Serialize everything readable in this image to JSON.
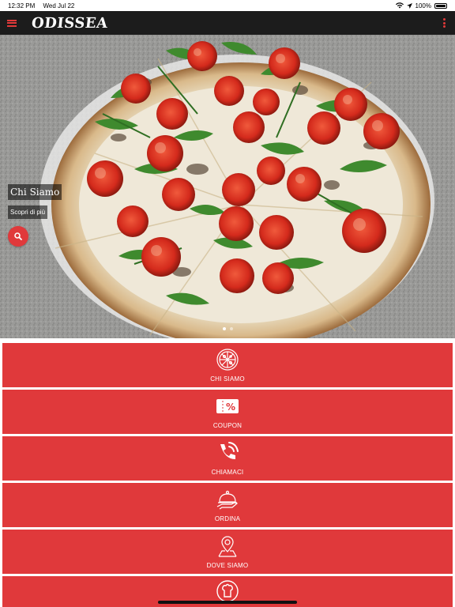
{
  "status": {
    "time": "12:32 PM",
    "date": "Wed Jul 22",
    "battery": "100%"
  },
  "app_bar": {
    "logo": "ODISSEA"
  },
  "hero": {
    "title": "Chi Siamo",
    "subtitle": "Scopri di più",
    "slide_count": 2,
    "active_slide": 1
  },
  "menu": {
    "items": [
      {
        "label": "CHI SIAMO",
        "icon": "pizza-icon"
      },
      {
        "label": "COUPON",
        "icon": "coupon-icon"
      },
      {
        "label": "CHIAMACI",
        "icon": "phone-icon"
      },
      {
        "label": "ORDINA",
        "icon": "cloche-icon"
      },
      {
        "label": "DOVE SIAMO",
        "icon": "map-pin-icon"
      },
      {
        "label": "",
        "icon": "chef-icon"
      }
    ]
  },
  "colors": {
    "accent": "#e0393b",
    "app_bar": "#1c1c1c"
  }
}
